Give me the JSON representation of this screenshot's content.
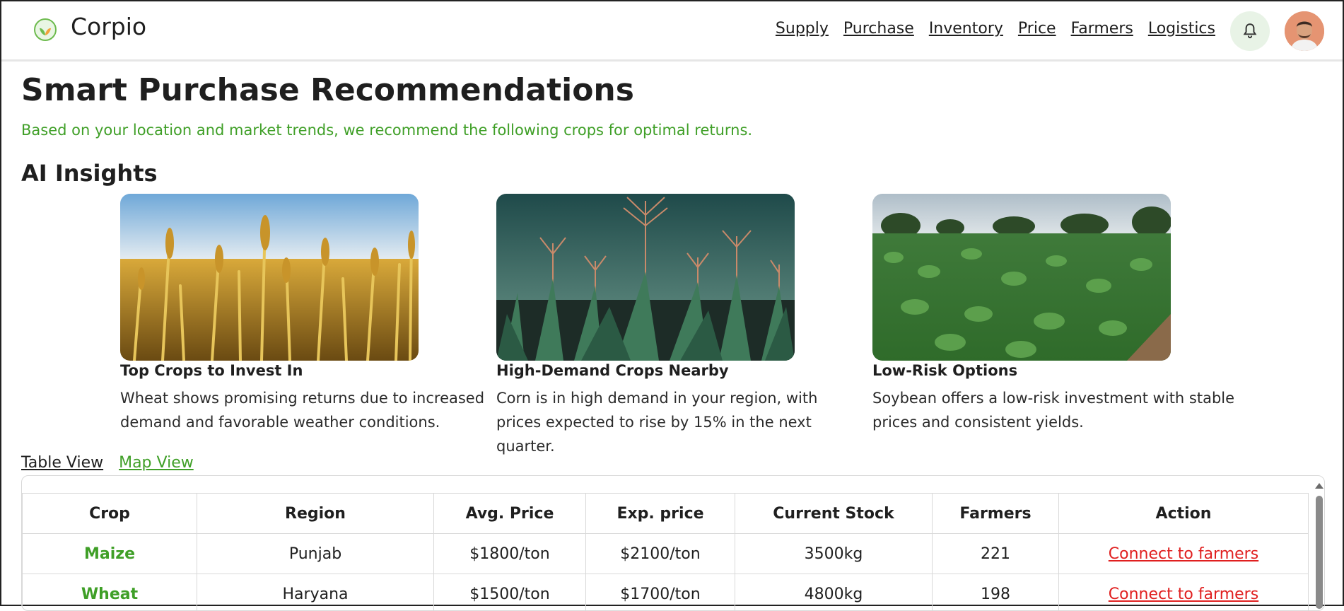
{
  "header": {
    "brand": "Corpio",
    "nav": [
      "Supply",
      "Purchase",
      "Inventory",
      "Price",
      "Farmers",
      "Logistics"
    ]
  },
  "page": {
    "title": "Smart Purchase Recommendations",
    "subtitle": "Based on your location and market trends, we recommend the following crops for optimal returns.",
    "section_title": "AI Insights"
  },
  "cards": [
    {
      "title": "Top Crops to Invest In",
      "desc": "Wheat shows promising returns due to increased demand and favorable weather conditions."
    },
    {
      "title": "High-Demand Crops Nearby",
      "desc": "Corn is in high demand in your region, with prices expected to rise by 15% in the next quarter."
    },
    {
      "title": "Low-Risk Options",
      "desc": "Soybean offers a low-risk investment with stable prices and consistent yields."
    }
  ],
  "tabs": {
    "table": "Table View",
    "map": "Map View"
  },
  "table": {
    "headers": [
      "Crop",
      "Region",
      "Avg. Price",
      "Exp. price",
      "Current Stock",
      "Farmers",
      "Action"
    ],
    "rows": [
      [
        "Maize",
        "Punjab",
        "$1800/ton",
        "$2100/ton",
        "3500kg",
        "221",
        "Connect to farmers"
      ],
      [
        "Wheat",
        "Haryana",
        "$1500/ton",
        "$1700/ton",
        "4800kg",
        "198",
        "Connect to farmers"
      ]
    ]
  },
  "colors": {
    "accent": "#3f9f27",
    "link_action": "#e02020"
  }
}
